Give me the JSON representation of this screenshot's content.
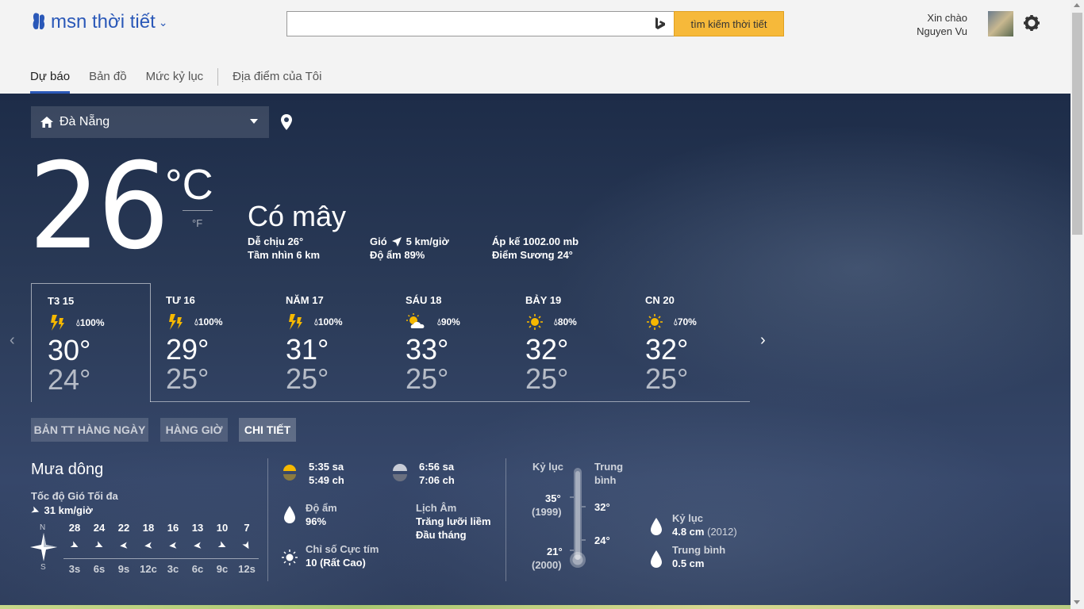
{
  "header": {
    "brand": "msn thời tiết",
    "search_placeholder": "",
    "search_button": "tìm kiếm thời tiết",
    "greeting": "Xin chào",
    "user_name": "Nguyen Vu"
  },
  "nav": {
    "tabs": [
      {
        "label": "Dự báo"
      },
      {
        "label": "Bản đồ"
      },
      {
        "label": "Mức kỷ lục"
      },
      {
        "label": "Địa điểm của Tôi"
      }
    ]
  },
  "location": {
    "name": "Đà Nẵng"
  },
  "current": {
    "temp": "26",
    "unit_c": "°C",
    "unit_f": "°F",
    "condition": "Có mây",
    "feels_like": "Dễ chịu 26°",
    "visibility": "Tầm nhìn 6 km",
    "wind": "Gió",
    "wind_speed": "5 km/giờ",
    "humidity": "Độ ẩm 89%",
    "pressure": "Áp kế 1002.00 mb",
    "dew_point": "Điểm Sương 24°"
  },
  "forecast": [
    {
      "day": "T3 15",
      "icon": "thunder-icon",
      "precip": "100%",
      "hi": "30°",
      "lo": "24°"
    },
    {
      "day": "TƯ 16",
      "icon": "thunder-icon",
      "precip": "100%",
      "hi": "29°",
      "lo": "25°"
    },
    {
      "day": "NĂM 17",
      "icon": "thunder-icon",
      "precip": "100%",
      "hi": "31°",
      "lo": "25°"
    },
    {
      "day": "SÁU 18",
      "icon": "partly-sunny-icon",
      "precip": "90%",
      "hi": "33°",
      "lo": "25°"
    },
    {
      "day": "BẢY 19",
      "icon": "sun-icon",
      "precip": "80%",
      "hi": "32°",
      "lo": "25°"
    },
    {
      "day": "CN 20",
      "icon": "sun-icon",
      "precip": "70%",
      "hi": "32°",
      "lo": "25°"
    }
  ],
  "view_tabs": [
    {
      "label": "BẢN TT HÀNG NGÀY"
    },
    {
      "label": "HÀNG GIỜ"
    },
    {
      "label": "CHI TIẾT"
    }
  ],
  "details": {
    "title": "Mưa dông",
    "wind_label": "Tốc độ Gió Tối đa",
    "wind_value": "31 km/giờ",
    "compass_n": "N",
    "compass_s": "S",
    "wind_speeds": [
      "28",
      "24",
      "22",
      "18",
      "16",
      "13",
      "10",
      "7"
    ],
    "wind_times": [
      "3s",
      "6s",
      "9s",
      "12c",
      "3c",
      "6c",
      "9c",
      "12s"
    ],
    "sunrise": "5:35 sa",
    "sunset": "5:49 ch",
    "moonrise": "6:56 sa",
    "moonset": "7:06 ch",
    "humidity_label": "Độ ẩm",
    "humidity_value": "96%",
    "lunar_label": "Lịch Âm",
    "lunar_value1": "Trăng lưỡi liềm",
    "lunar_value2": "Đầu tháng",
    "uv_label": "Chỉ số Cực tím",
    "uv_value": "10 (Rất Cao)",
    "record_label": "Kỷ lục",
    "avg_label1": "Trung",
    "avg_label2": "bình",
    "record_high": "35°",
    "record_high_year": "(1999)",
    "record_low": "21°",
    "record_low_year": "(2000)",
    "avg_high": "32°",
    "avg_low": "24°",
    "rain_record_label": "Kỷ lục",
    "rain_record_value": "4.8 cm",
    "rain_record_year": "(2012)",
    "rain_avg_label": "Trung bình",
    "rain_avg_value": "0.5 cm"
  },
  "colors": {
    "accent": "#2a58b8",
    "search_button": "#f6b93a",
    "sun": "#f5b800"
  }
}
